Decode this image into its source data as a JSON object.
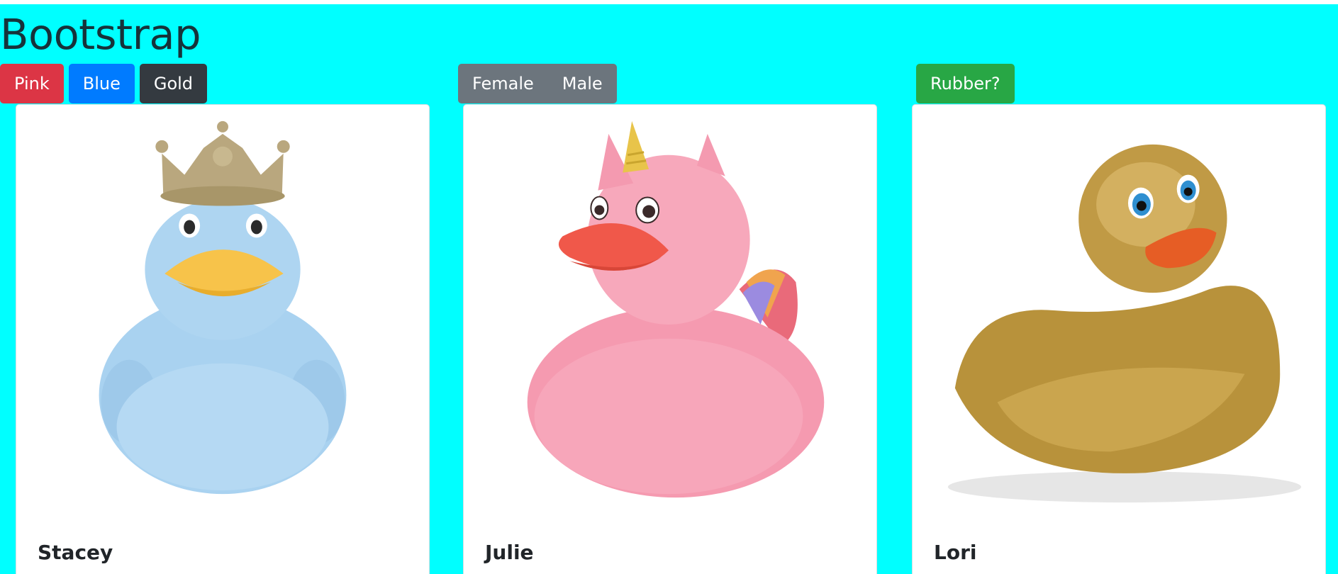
{
  "header": {
    "title": "Bootstrap"
  },
  "filters": {
    "colors": [
      {
        "label": "Pink",
        "color": "#dc3545"
      },
      {
        "label": "Blue",
        "color": "#007bff"
      },
      {
        "label": "Gold",
        "color": "#343a40"
      }
    ],
    "gender": [
      {
        "label": "Female"
      },
      {
        "label": "Male"
      }
    ],
    "rubber": {
      "label": "Rubber?",
      "color": "#28a745"
    }
  },
  "cards": [
    {
      "title": "Stacey",
      "image": "blue-duck-with-crown"
    },
    {
      "title": "Julie",
      "image": "pink-unicorn-duck"
    },
    {
      "title": "Lori",
      "image": "gold-duck"
    }
  ],
  "theme": {
    "background": "#00ffff",
    "card_bg": "#ffffff"
  }
}
